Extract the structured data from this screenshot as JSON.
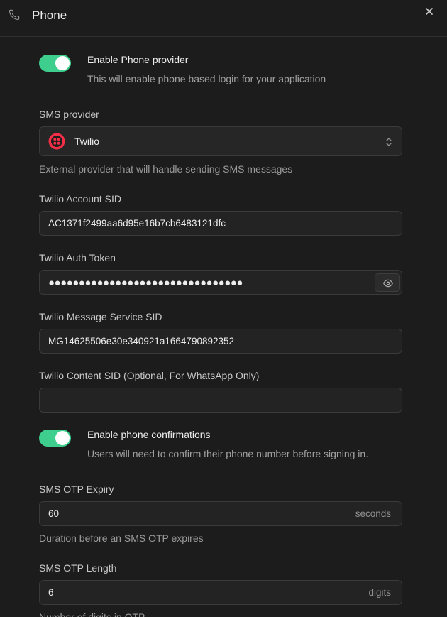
{
  "header": {
    "title": "Phone",
    "icons": {
      "phone": "phone-icon",
      "close": "close-icon"
    }
  },
  "enable_provider": {
    "label": "Enable Phone provider",
    "description": "This will enable phone based login for your application",
    "enabled": true
  },
  "sms_provider": {
    "label": "SMS provider",
    "value": "Twilio",
    "icon": "twilio-logo-icon",
    "helper": "External provider that will handle sending SMS messages"
  },
  "account_sid": {
    "label": "Twilio Account SID",
    "value": "AC1371f2499aa6d95e16b7cb6483121dfc"
  },
  "auth_token": {
    "label": "Twilio Auth Token",
    "masked_value": "●●●●●●●●●●●●●●●●●●●●●●●●●●●●●●●●",
    "icon": "eye-icon"
  },
  "message_service_sid": {
    "label": "Twilio Message Service SID",
    "value": "MG14625506e30e340921a1664790892352"
  },
  "content_sid": {
    "label": "Twilio Content SID (Optional, For WhatsApp Only)",
    "value": ""
  },
  "phone_confirmations": {
    "label": "Enable phone confirmations",
    "description": "Users will need to confirm their phone number before signing in.",
    "enabled": true
  },
  "otp_expiry": {
    "label": "SMS OTP Expiry",
    "value": "60",
    "suffix": "seconds",
    "helper": "Duration before an SMS OTP expires"
  },
  "otp_length": {
    "label": "SMS OTP Length",
    "value": "6",
    "suffix": "digits",
    "helper": "Number of digits in OTP"
  },
  "colors": {
    "accent": "#3ecf8e",
    "background": "#1c1c1c",
    "twilio": "#f22f46"
  }
}
